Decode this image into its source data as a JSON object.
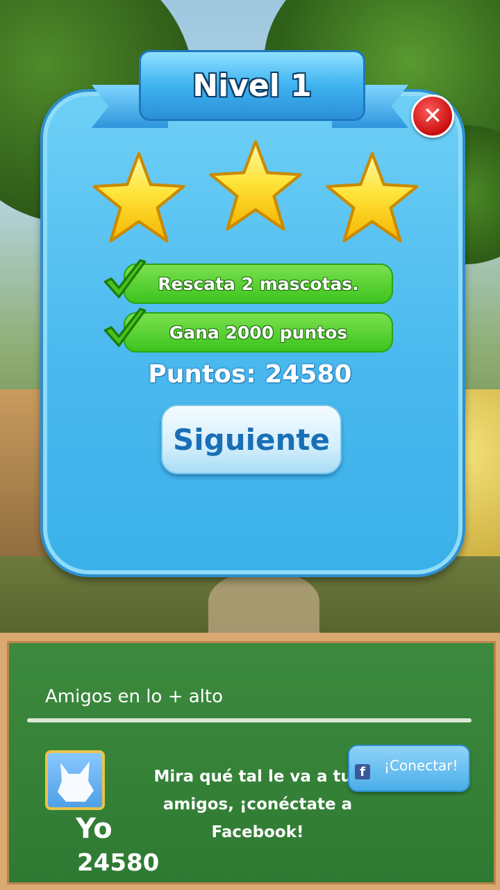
{
  "level": {
    "title": "Nivel 1",
    "stars_earned": 3,
    "stars_total": 3
  },
  "goals": [
    {
      "label": "Rescata 2 mascotas.",
      "completed": true
    },
    {
      "label": "Gana 2000 puntos",
      "completed": true
    }
  ],
  "score_text": "Puntos: 24580",
  "next_button": "Siguiente",
  "close_icon": "close-icon",
  "leaderboard": {
    "title": "Amigos en lo + alto",
    "player_name": "Yo",
    "player_score": "24580",
    "invite_text": "Mira qué tal le va a tus amigos, ¡conéctate a Facebook!",
    "connect_button": "¡Conectar!",
    "facebook_icon": "f"
  },
  "colors": {
    "dialog_blue": "#4ab9ee",
    "goal_green": "#3cc41e",
    "board_green": "#2f7a33",
    "star_yellow": "#ffd21a",
    "close_red": "#c90f0f"
  }
}
